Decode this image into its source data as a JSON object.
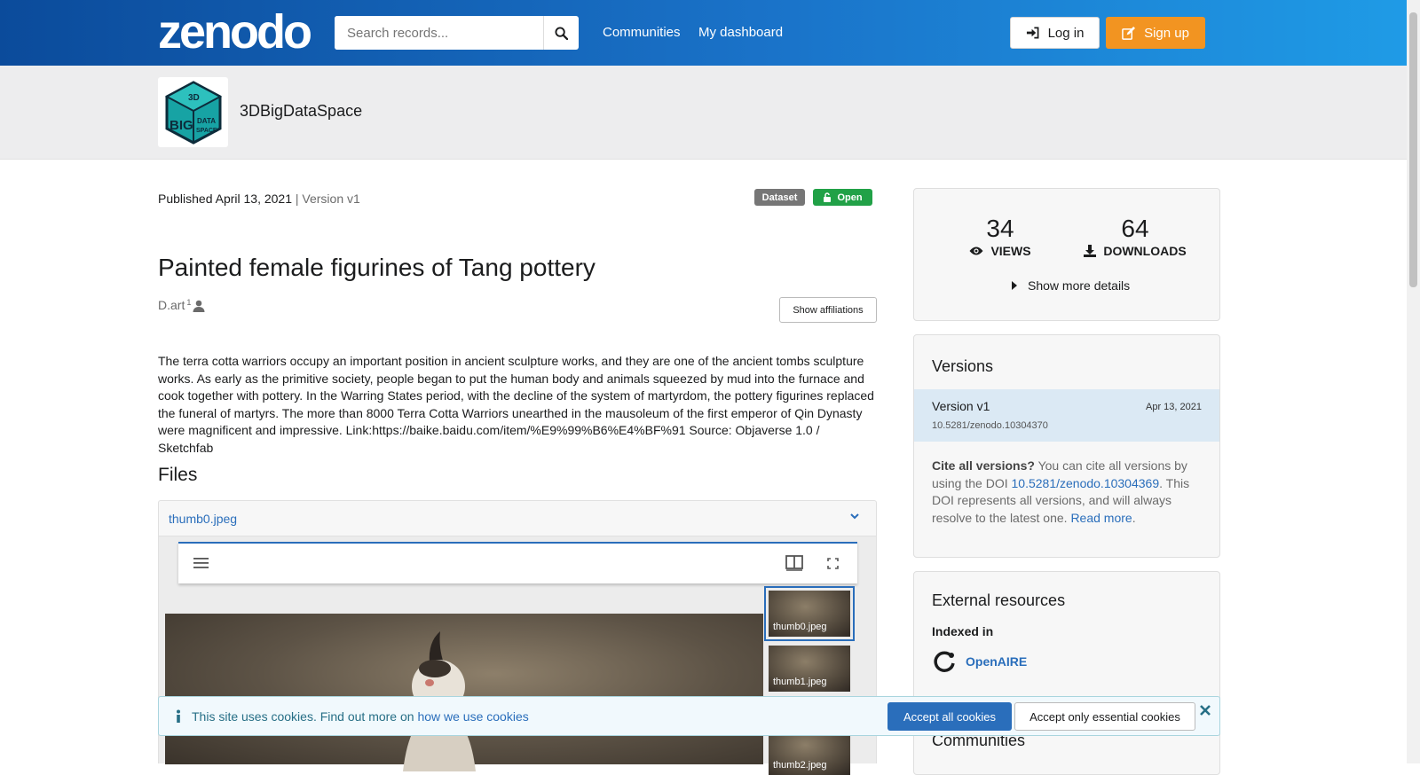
{
  "header": {
    "logo_text": "zenodo",
    "search_placeholder": "Search records...",
    "nav": [
      "Communities",
      "My dashboard"
    ],
    "login_label": "Log in",
    "signup_label": "Sign up",
    "brand_colors": {
      "gradient_start": "#0b4b9b",
      "gradient_end": "#1f9be6",
      "signup": "#f29421"
    }
  },
  "community": {
    "name": "3DBigDataSpace",
    "logo_text": [
      "3D",
      "BIG",
      "DATA",
      "SPACE"
    ]
  },
  "record": {
    "published": "Published April 13, 2021",
    "version": "Version v1",
    "badges": {
      "type": "Dataset",
      "access": "Open"
    },
    "title": "Painted female figurines of Tang pottery",
    "author": "D.art",
    "author_sup": "1",
    "show_affiliations": "Show affiliations",
    "description": "The terra cotta warriors occupy an important position in ancient sculpture works, and they are one of the ancient tombs sculpture works. As early as the primitive society, people began to put the human body and animals squeezed by mud into the furnace and cook together with pottery. In the Warring States period, with the decline of the system of martyrdom, the pottery figurines replaced the funeral of martyrs. The more than 8000 Terra Cotta Warriors unearthed in the mausoleum of the first emperor of Qin Dynasty were magnificent and impressive. Link:https://baike.baidu.com/item/%E9%99%B6%E4%BF%91 Source: Objaverse 1.0 / Sketchfab"
  },
  "files": {
    "title": "Files",
    "selected": "thumb0.jpeg",
    "thumbnails": [
      "thumb0.jpeg",
      "thumb1.jpeg",
      "thumb2.jpeg"
    ]
  },
  "stats": {
    "views": "34",
    "views_label": "VIEWS",
    "downloads": "64",
    "downloads_label": "DOWNLOADS",
    "more_details": "Show more details"
  },
  "versions": {
    "title": "Versions",
    "items": [
      {
        "label": "Version v1",
        "date": "Apr 13, 2021",
        "doi": "10.5281/zenodo.10304370"
      }
    ],
    "cite_bold": "Cite all versions?",
    "cite_text1": " You can cite all versions by using the DOI ",
    "cite_doi": "10.5281/zenodo.10304369",
    "cite_text2": ". This DOI represents all versions, and will always resolve to the latest one. ",
    "cite_read_more": "Read more",
    "cite_end": "."
  },
  "external": {
    "title": "External resources",
    "indexed_in": "Indexed in",
    "openaire": "OpenAIRE"
  },
  "communities_title": "Communities",
  "cookie": {
    "text": "This site uses cookies. Find out more on ",
    "link": "how we use cookies",
    "accept_all": "Accept all cookies",
    "accept_essential": "Accept only essential cookies"
  }
}
